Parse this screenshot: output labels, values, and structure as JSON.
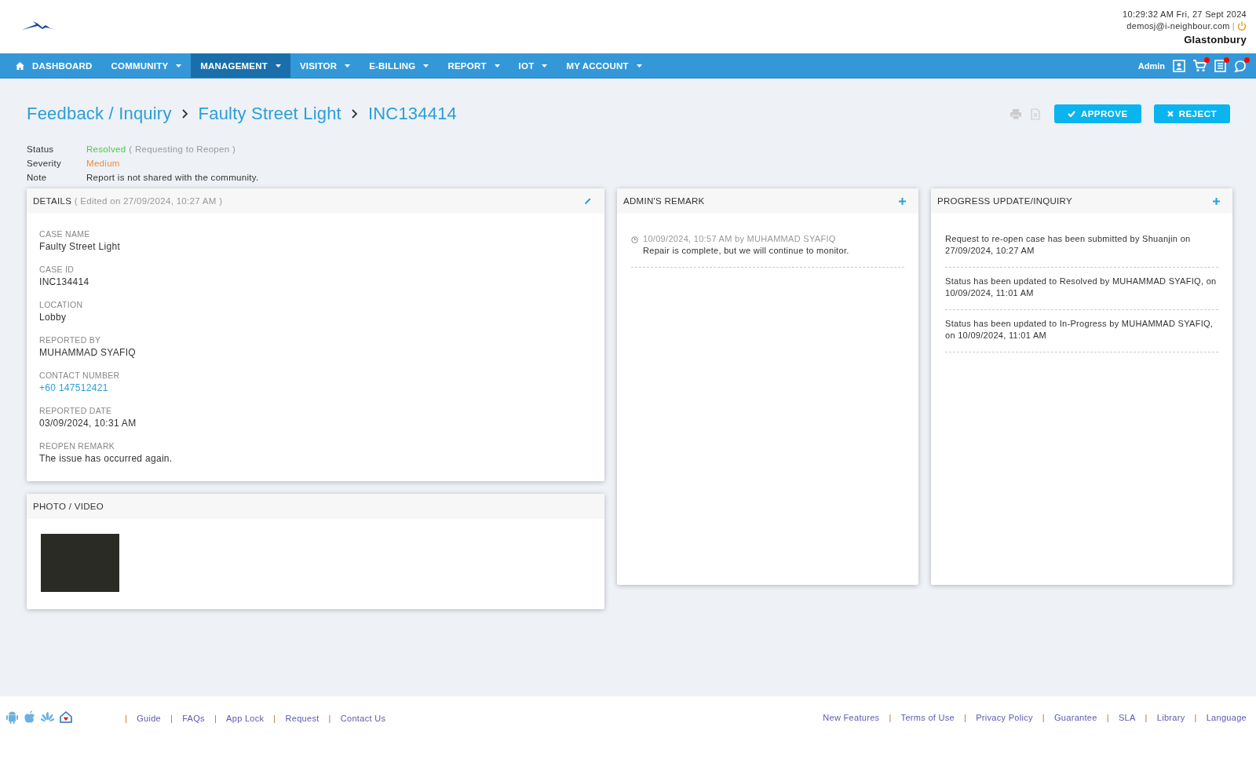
{
  "header": {
    "datetime": "10:29:32 AM  Fri, 27 Sept 2024",
    "email": "demosj@i-neighbour.com",
    "separator": "|",
    "community": "Glastonbury"
  },
  "nav": {
    "items": [
      {
        "label": "DASHBOARD",
        "kind": "home",
        "dropdown": false,
        "selected": false
      },
      {
        "label": "COMMUNITY",
        "kind": "menu",
        "dropdown": true,
        "selected": false
      },
      {
        "label": "MANAGEMENT",
        "kind": "menu",
        "dropdown": true,
        "selected": true
      },
      {
        "label": "VISITOR",
        "kind": "menu",
        "dropdown": true,
        "selected": false
      },
      {
        "label": "E-BILLING",
        "kind": "menu",
        "dropdown": true,
        "selected": false
      },
      {
        "label": "REPORT",
        "kind": "menu",
        "dropdown": true,
        "selected": false
      },
      {
        "label": "IOT",
        "kind": "menu",
        "dropdown": true,
        "selected": false
      },
      {
        "label": "MY ACCOUNT",
        "kind": "menu",
        "dropdown": true,
        "selected": false
      }
    ],
    "user": "Admin",
    "icons": [
      {
        "kind": "profile",
        "badge": false
      },
      {
        "kind": "cart",
        "badge": true
      },
      {
        "kind": "document",
        "badge": true
      },
      {
        "kind": "chat",
        "badge": true
      }
    ]
  },
  "breadcrumb": [
    "Feedback / Inquiry",
    "Faulty Street Light",
    "INC134414"
  ],
  "actions": [
    {
      "label": "APPROVE",
      "kind": "approve"
    },
    {
      "label": "REJECT",
      "kind": "reject"
    }
  ],
  "summary": [
    {
      "label": "Status",
      "value": "Resolved",
      "color": "#4cc94c",
      "suffix": "( Requesting to Reopen )"
    },
    {
      "label": "Severity",
      "value": "Medium",
      "color": "#f08c3c"
    },
    {
      "label": "Note",
      "value": "Report is not shared with the community.",
      "color": "#333333"
    }
  ],
  "details": {
    "title": "DETAILS",
    "edited": "( Edited on 27/09/2024, 10:27 AM )",
    "fields": [
      {
        "label": "CASE NAME",
        "value": "Faulty Street Light",
        "kind": "text"
      },
      {
        "label": "CASE ID",
        "value": "INC134414",
        "kind": "text"
      },
      {
        "label": "LOCATION",
        "value": "Lobby",
        "kind": "text"
      },
      {
        "label": "REPORTED BY",
        "value": "MUHAMMAD SYAFIQ",
        "kind": "text"
      },
      {
        "label": "CONTACT NUMBER",
        "value": "+60 147512421",
        "kind": "link"
      },
      {
        "label": "REPORTED DATE",
        "value": "03/09/2024, 10:31 AM",
        "kind": "text"
      },
      {
        "label": "REOPEN REMARK",
        "value": "The issue has occurred again.",
        "kind": "text"
      }
    ]
  },
  "media": {
    "title": "PHOTO / VIDEO"
  },
  "admin_remark": {
    "title": "ADMIN'S REMARK",
    "entries": [
      {
        "meta": "10/09/2024, 10:57 AM by MUHAMMAD SYAFIQ",
        "text": "Repair is complete, but we will continue to monitor."
      }
    ]
  },
  "progress": {
    "title": "PROGRESS UPDATE/INQUIRY",
    "entries": [
      "Request to re-open case has been submitted by Shuanjin on 27/09/2024, 10:27 AM",
      "Status has been updated to Resolved by MUHAMMAD SYAFIQ, on 10/09/2024, 11:01 AM",
      "Status has been updated to In-Progress by MUHAMMAD SYAFIQ, on 10/09/2024, 11:01 AM"
    ]
  },
  "footer": {
    "left": [
      {
        "sep": "|",
        "label": "Guide"
      },
      {
        "sep": "|",
        "label": "FAQs"
      },
      {
        "sep": "|",
        "label": "App Lock"
      },
      {
        "sep": "|",
        "label": "Request"
      },
      {
        "sep": "|",
        "label": "Contact Us"
      }
    ],
    "right": [
      {
        "label": "New Features",
        "sep": "|"
      },
      {
        "label": "Terms of Use",
        "sep": "|"
      },
      {
        "label": "Privacy Policy",
        "sep": "|"
      },
      {
        "label": "Guarantee",
        "sep": "|"
      },
      {
        "label": "SLA",
        "sep": "|"
      },
      {
        "label": "Library",
        "sep": "|"
      },
      {
        "label": "Language"
      }
    ]
  }
}
